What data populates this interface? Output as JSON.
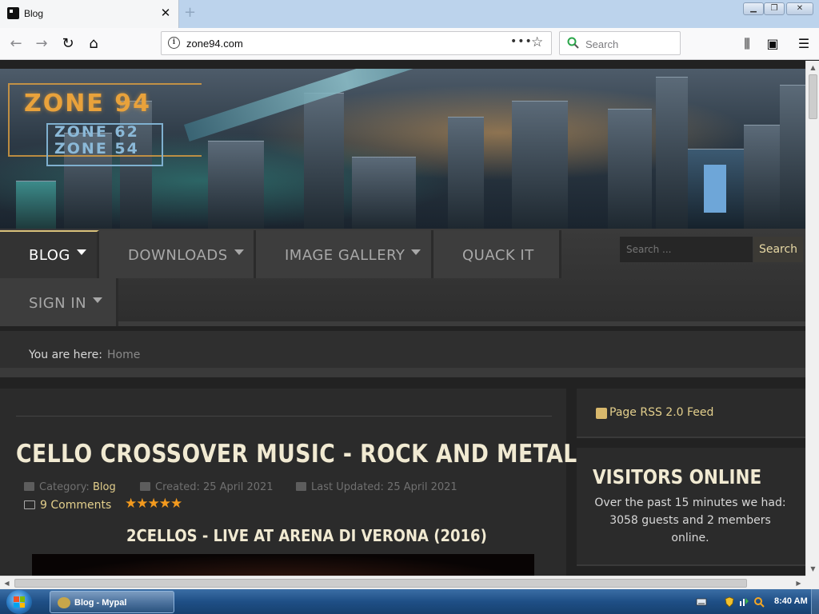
{
  "browser": {
    "tab_title": "Blog",
    "tab_close": "✕",
    "new_tab": "+",
    "url": "zone94.com",
    "url_more": "•••",
    "search_placeholder": "Search",
    "window_controls": {
      "minimize": "▁",
      "restore": "❐",
      "close": "✕"
    }
  },
  "site": {
    "logo": {
      "main": "ZONE 94",
      "sub1": "ZONE 62",
      "sub2": "ZONE 54"
    },
    "menu": [
      {
        "label": "BLOG",
        "has_dropdown": true,
        "active": true
      },
      {
        "label": "DOWNLOADS",
        "has_dropdown": true,
        "active": false
      },
      {
        "label": "IMAGE GALLERY",
        "has_dropdown": true,
        "active": false
      },
      {
        "label": "QUACK IT",
        "has_dropdown": false,
        "active": false
      },
      {
        "label": "SIGN IN",
        "has_dropdown": true,
        "active": false
      }
    ],
    "search": {
      "placeholder": "Search ...",
      "button": "Search"
    },
    "breadcrumb": {
      "label": "You are here:",
      "home": "Home"
    },
    "article": {
      "title": "CELLO CROSSOVER MUSIC - ROCK AND METAL",
      "category_label": "Category:",
      "category": "Blog",
      "created": "Created: 25 April 2021",
      "updated": "Last Updated: 25 April 2021",
      "comments": "9 Comments",
      "rating": 5,
      "rating_stars": "★★★★★",
      "video_title": "2CELLOS - LIVE AT ARENA DI VERONA (2016)"
    },
    "sidebar": {
      "rss": "Page RSS 2.0 Feed",
      "visitors_title": "VISITORS ONLINE",
      "visitors_text": "Over the past 15 minutes we had: 3058 guests and 2 members online."
    }
  },
  "taskbar": {
    "window_label": "Blog - Mypal",
    "clock": "8:40 AM"
  },
  "colors": {
    "accent_gold": "#e3cf8c",
    "heading": "#f1ead2",
    "star": "#f39a1e",
    "logo_orange": "#e9a23b",
    "logo_blue": "#8bb9d8"
  }
}
